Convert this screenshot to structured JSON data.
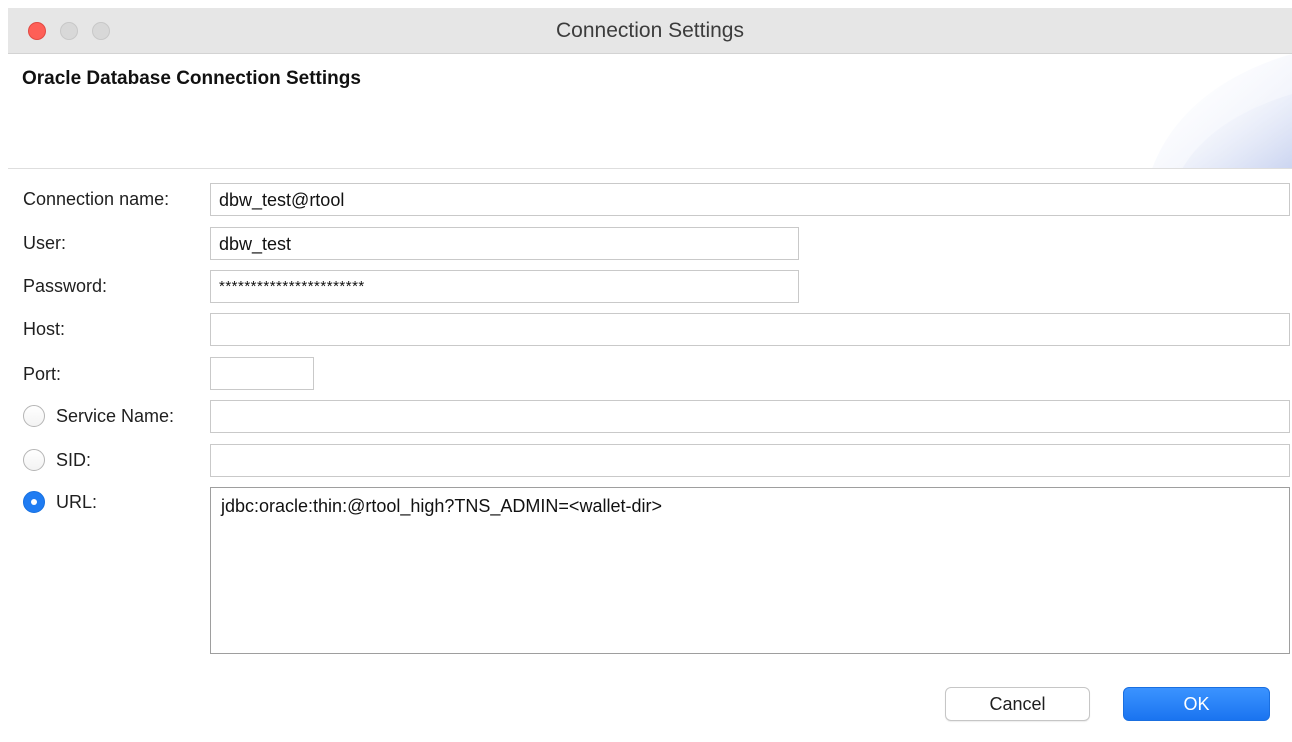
{
  "window": {
    "title": "Connection Settings"
  },
  "header": {
    "title": "Oracle Database Connection Settings"
  },
  "form": {
    "connection_name": {
      "label": "Connection name:",
      "value": "dbw_test@rtool"
    },
    "user": {
      "label": "User:",
      "value": "dbw_test"
    },
    "password": {
      "label": "Password:",
      "value": "***********************"
    },
    "host": {
      "label": "Host:",
      "value": ""
    },
    "port": {
      "label": "Port:",
      "value": ""
    },
    "service_name": {
      "label": "Service Name:",
      "value": "",
      "selected": false
    },
    "sid": {
      "label": "SID:",
      "value": "",
      "selected": false
    },
    "url": {
      "label": "URL:",
      "value": "jdbc:oracle:thin:@rtool_high?TNS_ADMIN=<wallet-dir>",
      "selected": true
    }
  },
  "buttons": {
    "cancel_label": "Cancel",
    "ok_label": "OK"
  },
  "colors": {
    "accent": "#1f7cf2",
    "close_button": "#fe5f57",
    "titlebar": "#e6e6e6"
  },
  "icons": {
    "close": "close-icon",
    "minimize": "minimize-icon",
    "maximize": "maximize-icon",
    "header_decoration": "header-swoosh-icon"
  }
}
